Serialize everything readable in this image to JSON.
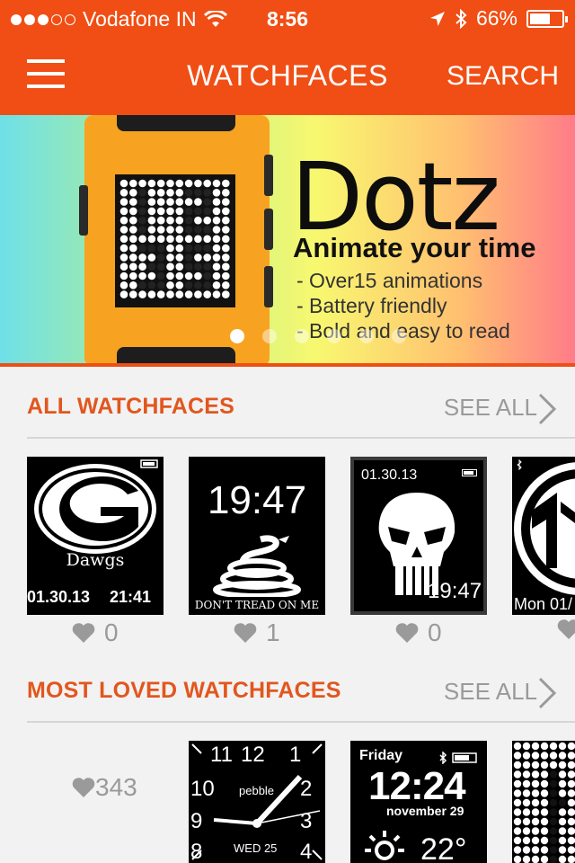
{
  "status_bar": {
    "carrier": "Vodafone IN",
    "time": "8:56",
    "battery": "66%",
    "signal_icon": "signal-dots-icon",
    "wifi_icon": "wifi-icon",
    "location_icon": "location-arrow-icon",
    "bluetooth_icon": "bluetooth-icon",
    "battery_level": 0.66
  },
  "nav": {
    "title": "WATCHFACES",
    "search_label": "SEARCH",
    "menu_icon": "hamburger-menu-icon"
  },
  "banner": {
    "title": "Dotz",
    "subtitle": "Animate your time",
    "points": [
      "- Over15 animations",
      "- Battery friendly",
      "- Bold and easy to read"
    ],
    "page_count": 6,
    "active_page": 1
  },
  "sections": {
    "all": {
      "title": "ALL WATCHFACES",
      "see_all": "SEE ALL",
      "items": [
        {
          "caption": "Dawgs",
          "date": "01.30.13",
          "time": "21:41",
          "likes": "0"
        },
        {
          "time": "19:47",
          "caption": "DON'T TREAD ON ME",
          "likes": "1"
        },
        {
          "date": "01.30.13",
          "time": "19:47",
          "likes": "0"
        },
        {
          "caption": "Mon 01/",
          "likes": ""
        }
      ]
    },
    "loved": {
      "title": "MOST LOVED WATCHFACES",
      "see_all": "SEE ALL",
      "items": [
        {
          "likes": "343"
        },
        {
          "brand": "pebble",
          "hours": [
            "11",
            "12",
            "1",
            "10",
            "2",
            "9",
            "3",
            "8",
            "4"
          ],
          "date": "WED 25"
        },
        {
          "day": "Friday",
          "time": "12:24",
          "date": "november 29",
          "temp": "22°"
        }
      ]
    }
  },
  "colors": {
    "brand": "#f04e14",
    "section_title": "#e2561e",
    "muted": "#9a9a9a",
    "background": "#f2f2f2"
  }
}
